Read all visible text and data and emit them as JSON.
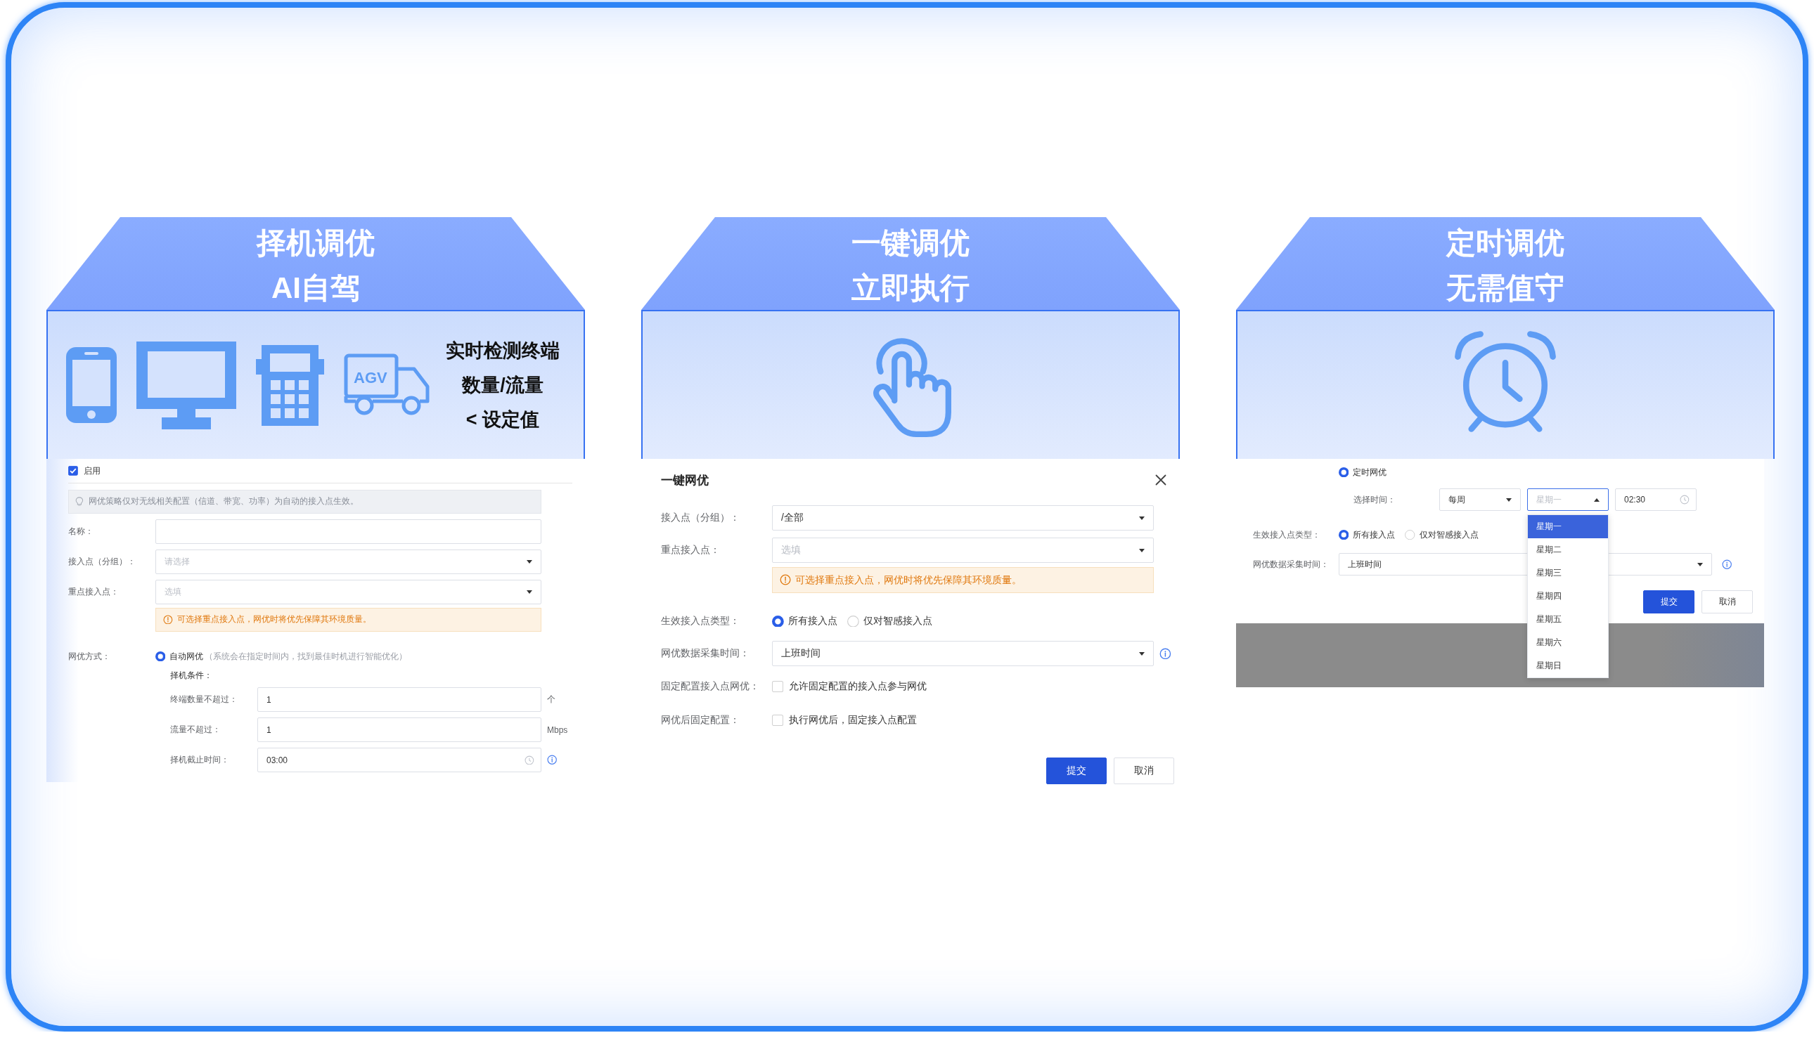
{
  "panels": [
    {
      "kind": "auto",
      "title": [
        "择机调优",
        "AI自驾"
      ],
      "truck_label": "AGV",
      "caption": [
        "实时检测终端",
        "数量/流量",
        "< 设定值"
      ],
      "rows": [
        {
          "kind": "enable",
          "label": "启用",
          "checked": true
        },
        {
          "kind": "notice",
          "text": "网优策略仅对无线相关配置（信道、带宽、功率）为自动的接入点生效。"
        },
        {
          "kind": "input",
          "label": "名称："
        },
        {
          "kind": "select",
          "label": "接入点（分组）：",
          "placeholder": "请选择",
          "expanded": false
        },
        {
          "kind": "select",
          "label": "重点接入点：",
          "placeholder": "选填",
          "expanded": false
        },
        {
          "kind": "warning",
          "text": "可选择重点接入点，网优时将优先保障其环境质量。"
        },
        {
          "kind": "radio",
          "label": "网优方式：",
          "options": [
            {
              "label": "自动网优",
              "note": "（系统会在指定时间内，找到最佳时机进行智能优化）",
              "selected": true,
              "children": [
                {
                  "kind": "heading",
                  "text": "择机条件："
                },
                {
                  "kind": "input",
                  "label": "终端数量不超过：",
                  "value": "1",
                  "suffix": "个"
                },
                {
                  "kind": "input",
                  "label": "流量不超过：",
                  "value": "1",
                  "suffix": "Mbps"
                },
                {
                  "kind": "time",
                  "label": "择机截止时间：",
                  "value": "03:00",
                  "info": true
                }
              ]
            }
          ]
        }
      ]
    },
    {
      "kind": "once",
      "title": [
        "一键调优",
        "立即执行"
      ],
      "dialog_title": "一键网优",
      "rows": [
        {
          "kind": "select",
          "label": "接入点（分组）：",
          "value": "/全部",
          "expanded": false
        },
        {
          "kind": "select",
          "label": "重点接入点：",
          "placeholder": "选填",
          "expanded": false
        },
        {
          "kind": "warning",
          "text": "可选择重点接入点，网优时将优先保障其环境质量。"
        },
        {
          "kind": "radio",
          "label": "生效接入点类型：",
          "options": [
            {
              "label": "所有接入点",
              "selected": true
            },
            {
              "label": "仅对智感接入点",
              "selected": false
            }
          ]
        },
        {
          "kind": "select",
          "label": "网优数据采集时间：",
          "value": "上班时间",
          "expanded": false,
          "info": true
        },
        {
          "kind": "checkbox",
          "label": "固定配置接入点网优：",
          "text": "允许固定配置的接入点参与网优",
          "checked": false
        },
        {
          "kind": "checkbox",
          "label": "网优后固定配置：",
          "text": "执行网优后，固定接入点配置",
          "checked": false
        }
      ],
      "buttons": [
        {
          "kind": "primary",
          "label": "提交"
        },
        {
          "kind": "default",
          "label": "取消"
        }
      ]
    },
    {
      "kind": "timer",
      "title": [
        "定时调优",
        "无需值守"
      ],
      "rows": [
        {
          "kind": "radio",
          "options": [
            {
              "label": "定时网优",
              "selected": true,
              "children": [
                {
                  "kind": "multi",
                  "label": "选择时间：",
                  "controls": [
                    {
                      "kind": "select",
                      "value": "每周",
                      "expanded": false
                    },
                    {
                      "kind": "select",
                      "placeholder": "星期一",
                      "expanded": true,
                      "options": [
                        {
                          "label": "星期一",
                          "selected": true
                        },
                        {
                          "label": "星期二",
                          "selected": false
                        },
                        {
                          "label": "星期三",
                          "selected": false
                        },
                        {
                          "label": "星期四",
                          "selected": false
                        },
                        {
                          "label": "星期五",
                          "selected": false
                        },
                        {
                          "label": "星期六",
                          "selected": false
                        },
                        {
                          "label": "星期日",
                          "selected": false
                        }
                      ]
                    },
                    {
                      "kind": "time",
                      "value": "02:30"
                    }
                  ]
                }
              ]
            }
          ]
        },
        {
          "kind": "radio",
          "label": "生效接入点类型：",
          "options": [
            {
              "label": "所有接入点",
              "selected": true
            },
            {
              "label": "仅对智感接入点",
              "selected": false
            }
          ]
        },
        {
          "kind": "select",
          "label": "网优数据采集时间：",
          "value": "上班时间",
          "expanded": false,
          "info": true
        }
      ],
      "buttons": [
        {
          "kind": "primary",
          "label": "提交"
        },
        {
          "kind": "default",
          "label": "取消"
        }
      ]
    }
  ]
}
